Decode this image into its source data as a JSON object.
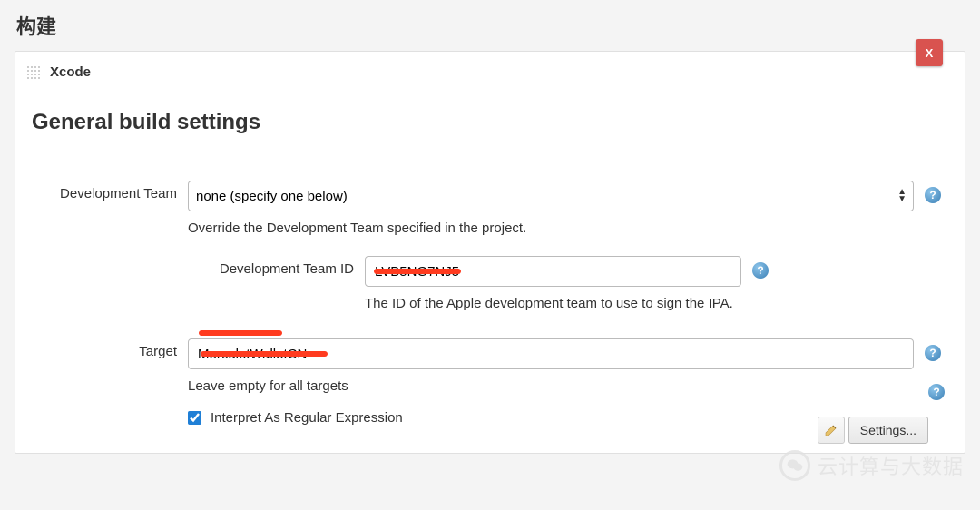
{
  "page": {
    "title": "构建"
  },
  "panel": {
    "name": "Xcode",
    "close_label": "X",
    "section_title": "General build settings"
  },
  "form": {
    "dev_team": {
      "label": "Development Team",
      "selected": "none (specify one below)",
      "help": "Override the Development Team specified in the project."
    },
    "dev_team_id": {
      "label": "Development Team ID",
      "value": "LVB5NG7NJ5",
      "help": "The ID of the Apple development team to use to sign the IPA."
    },
    "target": {
      "label": "Target",
      "value": "MerculetWalletCN",
      "help": "Leave empty for all targets"
    },
    "regex": {
      "label": "Interpret As Regular Expression",
      "checked": true
    }
  },
  "footer": {
    "settings_label": "Settings..."
  },
  "watermark": {
    "text": "云计算与大数据"
  },
  "icons": {
    "help": "?"
  }
}
